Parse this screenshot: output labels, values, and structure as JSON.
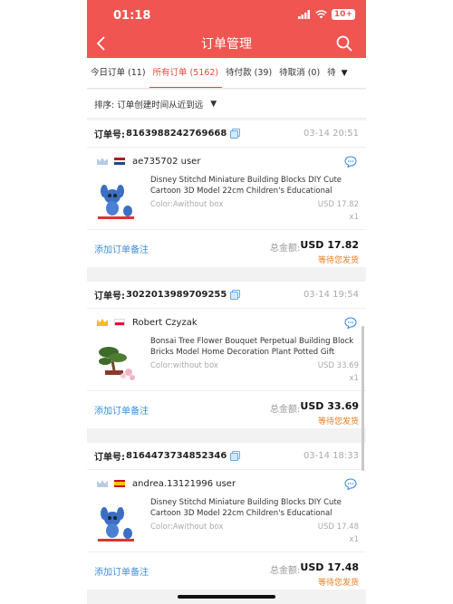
{
  "status_bar": {
    "time": "01:18",
    "battery": "10+"
  },
  "nav": {
    "title": "订单管理"
  },
  "tabs": [
    {
      "label": "今日订单 (11)"
    },
    {
      "label": "所有订单 (5162)"
    },
    {
      "label": "待付款 (39)"
    },
    {
      "label": "待取消 (0)"
    },
    {
      "label": "待"
    }
  ],
  "sort": {
    "label": "排序: 订单创建时间从近到远"
  },
  "labels": {
    "order_no": "订单号:",
    "add_note": "添加订单备注",
    "total": "总金额:"
  },
  "orders": [
    {
      "order_no": "8163988242769668",
      "time": "03-14 20:51",
      "buyer": "ae735702 user",
      "flag": "netherlands",
      "item_title": "Disney Stitchd Miniature Building Blocks DIY Cute Cartoon 3D Model 22cm Children's Educational Buildi...",
      "item_color": "Color:Awithout box",
      "item_price": "USD 17.82",
      "item_qty": "x1",
      "total": "USD 17.82",
      "status": "等待您发货"
    },
    {
      "order_no": "3022013989709255",
      "time": "03-14 19:54",
      "buyer": "Robert Czyzak",
      "flag": "poland",
      "item_title": "Bonsai Tree Flower Bouquet Perpetual Building Block Bricks Model Home Decoration Plant Potted Gift Kids...",
      "item_color": "Color:without box",
      "item_price": "USD 33.69",
      "item_qty": "x1",
      "total": "USD 33.69",
      "status": "等待您发货"
    },
    {
      "order_no": "8164473734852346",
      "time": "03-14 18:33",
      "buyer": "andrea.13121996 user",
      "flag": "spain",
      "item_title": "Disney Stitchd Miniature Building Blocks DIY Cute Cartoon 3D Model 22cm Children's Educational Buildi...",
      "item_color": "Color:Awithout box",
      "item_price": "USD 17.48",
      "item_qty": "x1",
      "total": "USD 17.48",
      "status": "等待您发货"
    }
  ],
  "colors": {
    "header_red": "#f05551",
    "active_tab": "#e8483e",
    "link_blue": "#3a8ee6",
    "status_orange": "#e67e22"
  }
}
